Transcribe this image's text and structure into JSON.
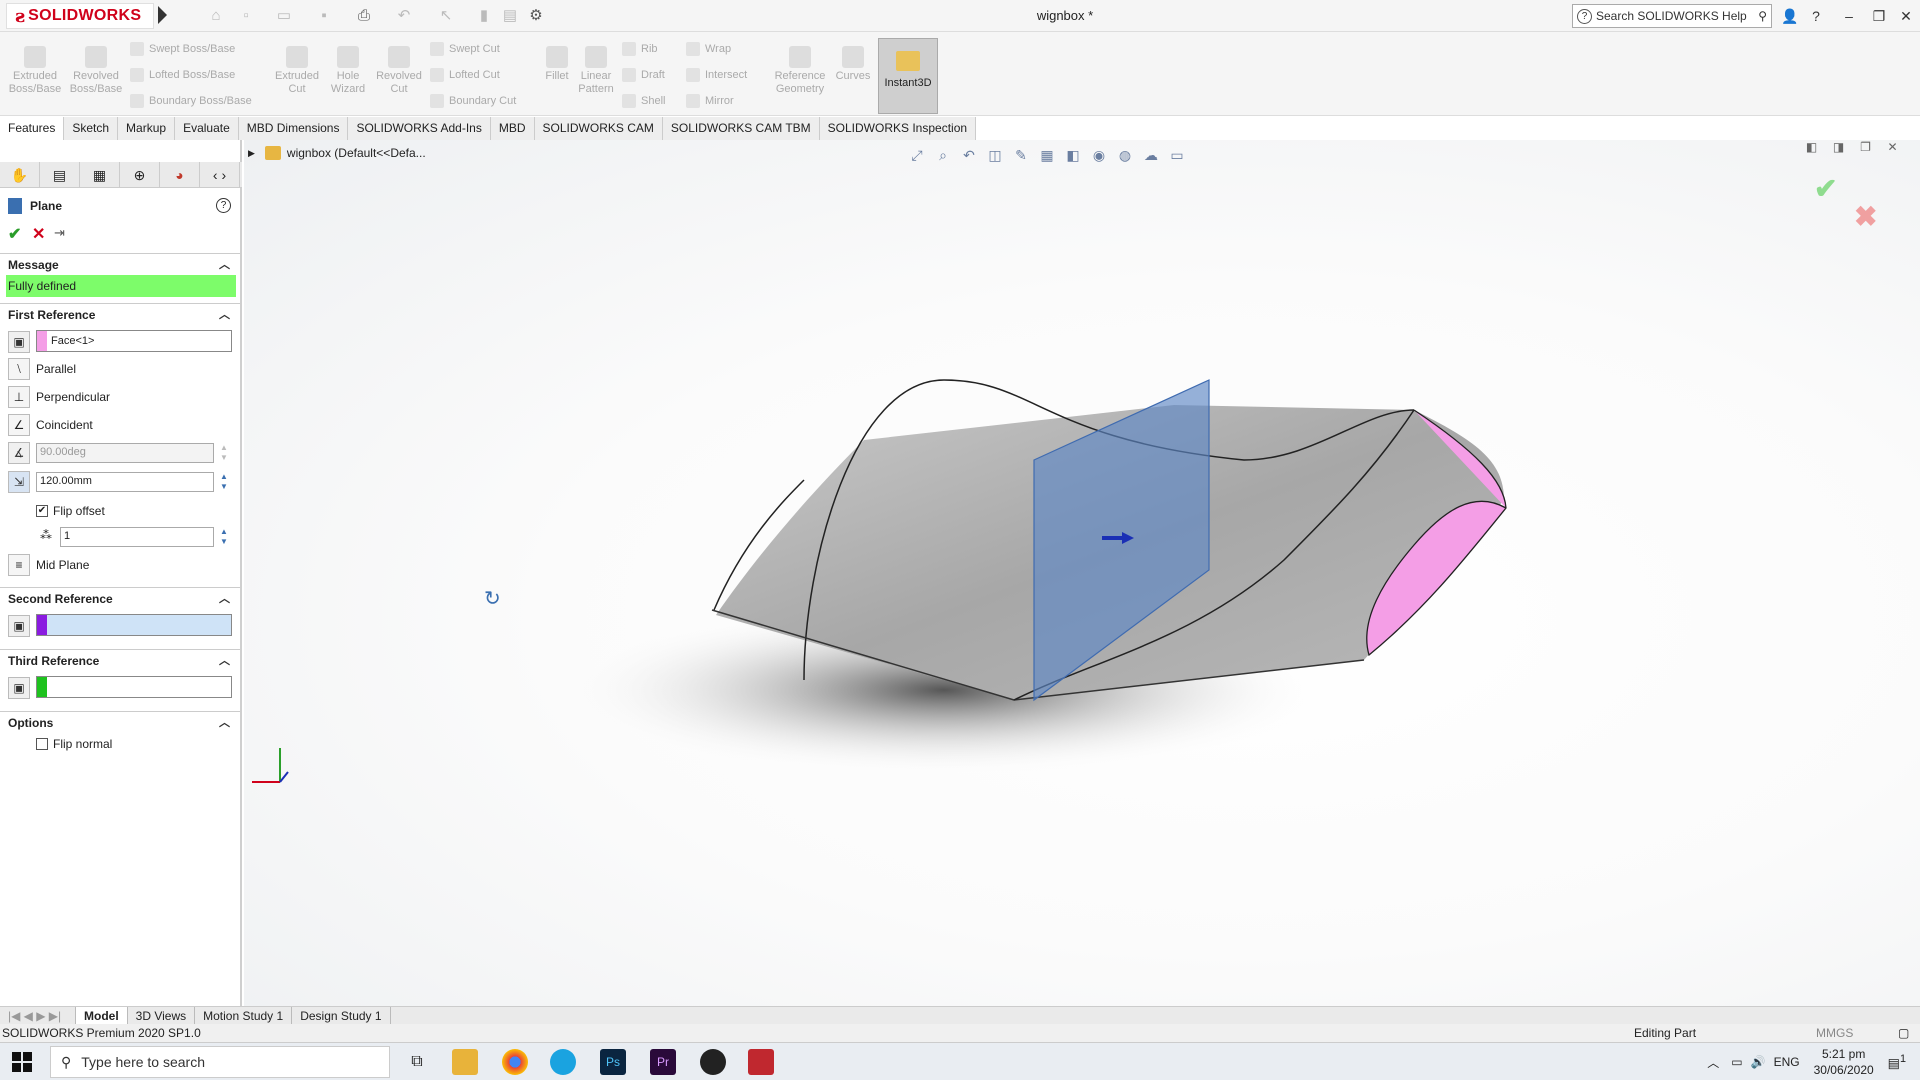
{
  "app": {
    "brand": "SOLIDWORKS",
    "title": "wignbox *",
    "help_search": "Search SOLIDWORKS Help"
  },
  "command_manager": {
    "big_buttons": [
      {
        "label": "Extruded\nBoss/Base"
      },
      {
        "label": "Revolved\nBoss/Base"
      },
      {
        "label": "Extruded\nCut"
      },
      {
        "label": "Hole\nWizard"
      },
      {
        "label": "Revolved\nCut"
      },
      {
        "label": "Fillet"
      },
      {
        "label": "Linear\nPattern"
      },
      {
        "label": "Reference\nGeometry"
      },
      {
        "label": "Curves"
      }
    ],
    "small_buttons": {
      "swept_boss": "Swept Boss/Base",
      "lofted_boss": "Lofted Boss/Base",
      "boundary_boss": "Boundary Boss/Base",
      "swept_cut": "Swept Cut",
      "lofted_cut": "Lofted Cut",
      "boundary_cut": "Boundary Cut",
      "rib": "Rib",
      "draft": "Draft",
      "shell": "Shell",
      "wrap": "Wrap",
      "intersect": "Intersect",
      "mirror": "Mirror"
    },
    "instant3d": "Instant3D"
  },
  "tabs": [
    "Features",
    "Sketch",
    "Markup",
    "Evaluate",
    "MBD Dimensions",
    "SOLIDWORKS Add-Ins",
    "MBD",
    "SOLIDWORKS CAM",
    "SOLIDWORKS CAM TBM",
    "SOLIDWORKS Inspection"
  ],
  "property_manager": {
    "title": "Plane",
    "message_header": "Message",
    "message": "Fully defined",
    "first_ref": {
      "header": "First Reference",
      "selection": "Face<1>",
      "parallel": "Parallel",
      "perpendicular": "Perpendicular",
      "coincident": "Coincident",
      "angle": "90.00deg",
      "distance": "120.00mm",
      "flip_offset": "Flip offset",
      "count": "1",
      "mid_plane": "Mid Plane"
    },
    "second_ref": {
      "header": "Second Reference"
    },
    "third_ref": {
      "header": "Third Reference"
    },
    "options": {
      "header": "Options",
      "flip_normal": "Flip normal"
    }
  },
  "viewport": {
    "tree_item": "wignbox (Default<<Defa..."
  },
  "bottom_tabs": [
    "Model",
    "3D Views",
    "Motion Study 1",
    "Design Study 1"
  ],
  "status": {
    "left": "SOLIDWORKS Premium 2020 SP1.0",
    "center": "Editing Part",
    "units": "MMGS"
  },
  "taskbar": {
    "search": "Type here to search",
    "lang": "ENG",
    "time": "5:21 pm",
    "date": "30/06/2020",
    "notif": "1"
  },
  "colors": {
    "brand": "#d0021b",
    "message_bg": "#7dfc6a",
    "face_pink": "#f49ee6",
    "plane_blue": "#5d87c4"
  }
}
